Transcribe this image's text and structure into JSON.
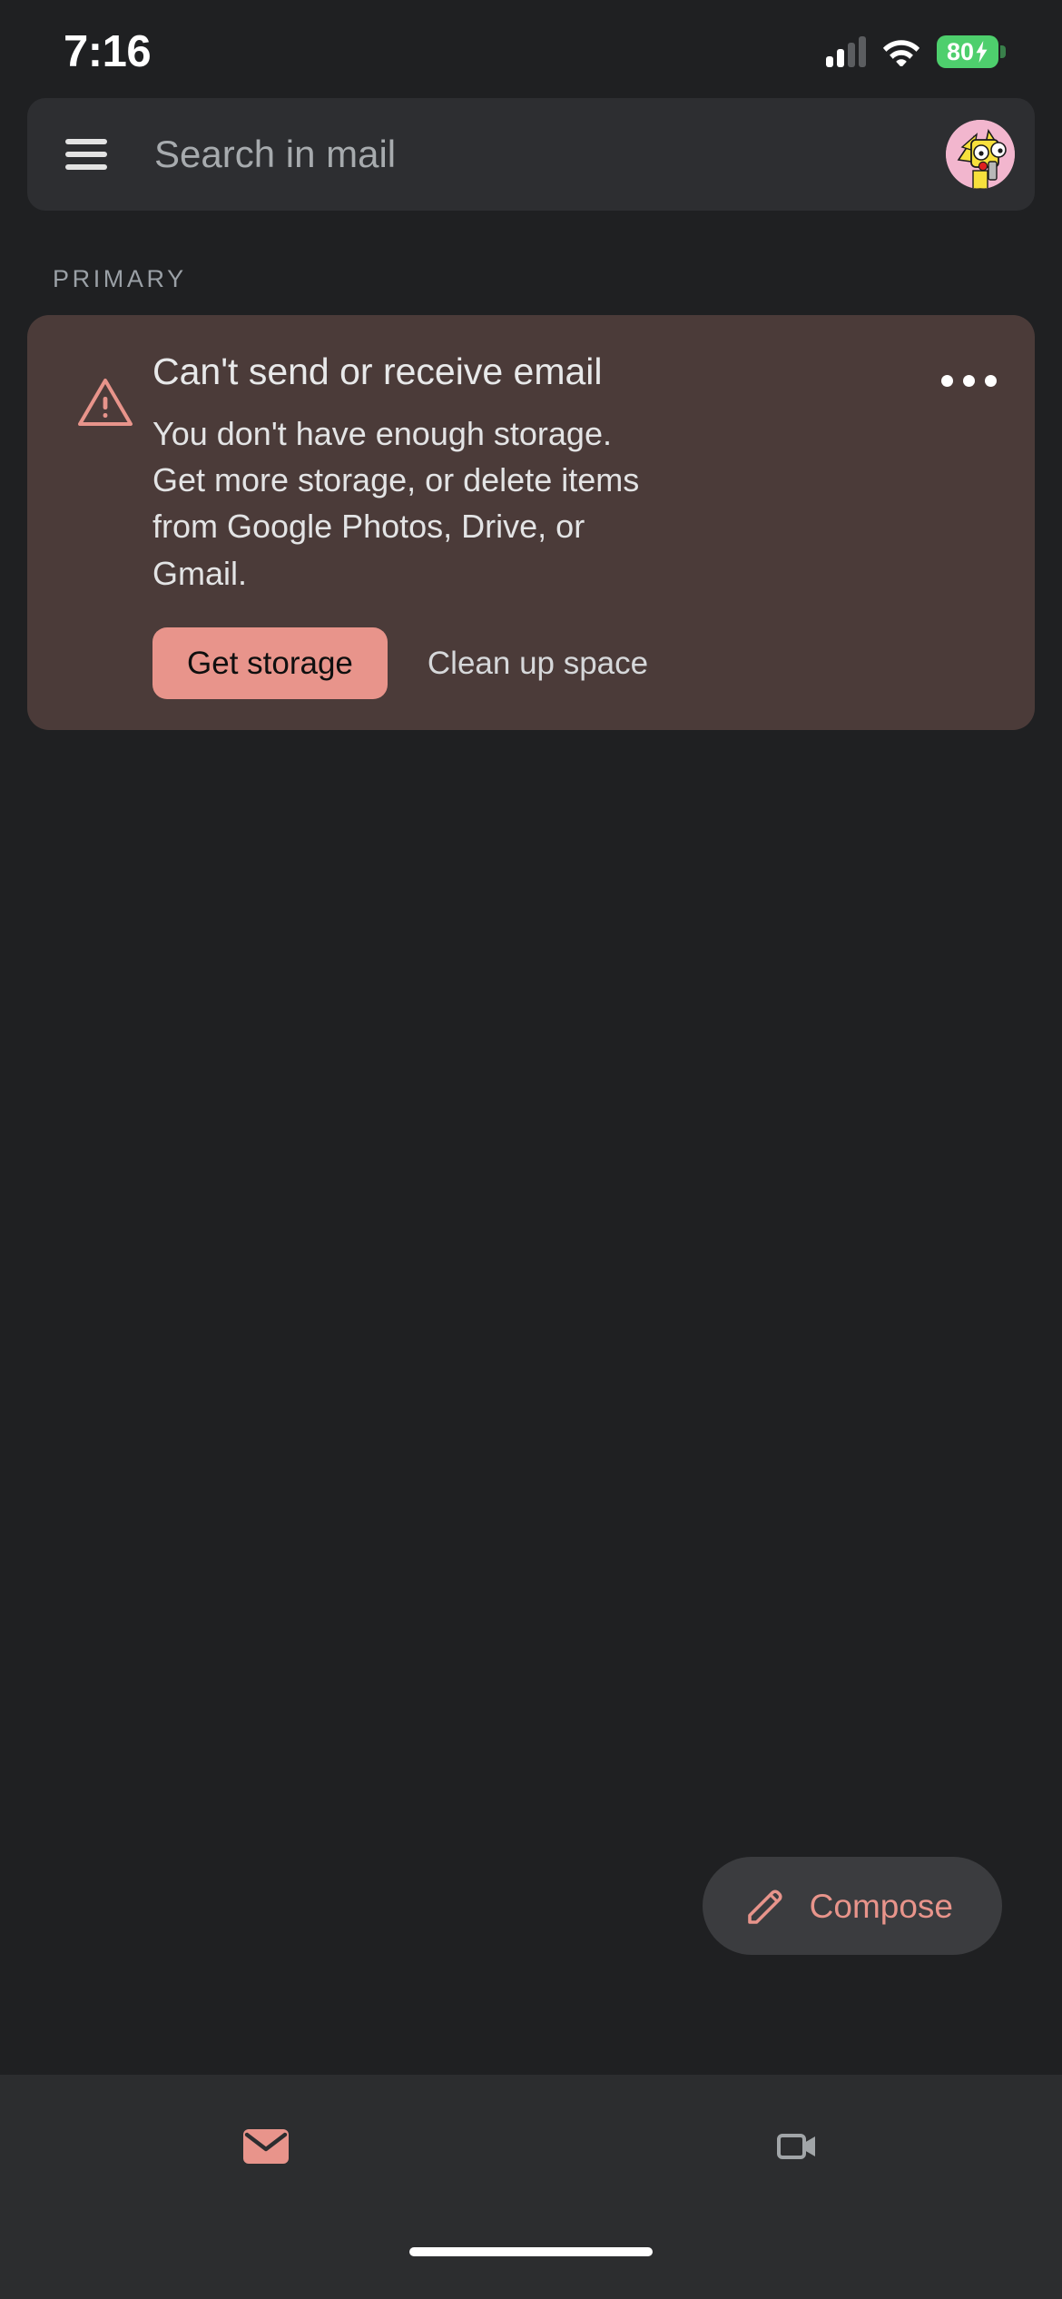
{
  "status_bar": {
    "time": "7:16",
    "signal_icon": "cellular-signal-icon",
    "signal_bars_active": 2,
    "signal_bars_total": 4,
    "wifi_icon": "wifi-icon",
    "battery_percent": "80",
    "battery_charging": true,
    "battery_color": "#4ecf6d"
  },
  "search": {
    "menu_icon": "hamburger-menu-icon",
    "placeholder": "Search in mail",
    "avatar_icon": "user-avatar"
  },
  "inbox": {
    "section_label": "PRIMARY"
  },
  "alert": {
    "warning_icon": "warning-triangle-icon",
    "title": "Can't send or receive email",
    "body": "You don't have enough storage. Get more storage, or delete items from Google Photos, Drive, or Gmail.",
    "primary_action": "Get storage",
    "secondary_action": "Clean up space",
    "overflow_icon": "more-options-icon",
    "card_color": "#4b3b39",
    "accent_color": "#e8948b"
  },
  "fab": {
    "icon": "pencil-compose-icon",
    "label": "Compose",
    "accent_color": "#e8948b",
    "background_color": "#3b3c3f"
  },
  "bottom_nav": {
    "items": [
      {
        "name": "mail",
        "icon": "mail-envelope-icon",
        "active": true,
        "color": "#e8948b"
      },
      {
        "name": "meet",
        "icon": "video-camera-icon",
        "active": false,
        "color": "#a1a5a8"
      }
    ]
  },
  "home_indicator": {
    "visible": true
  }
}
